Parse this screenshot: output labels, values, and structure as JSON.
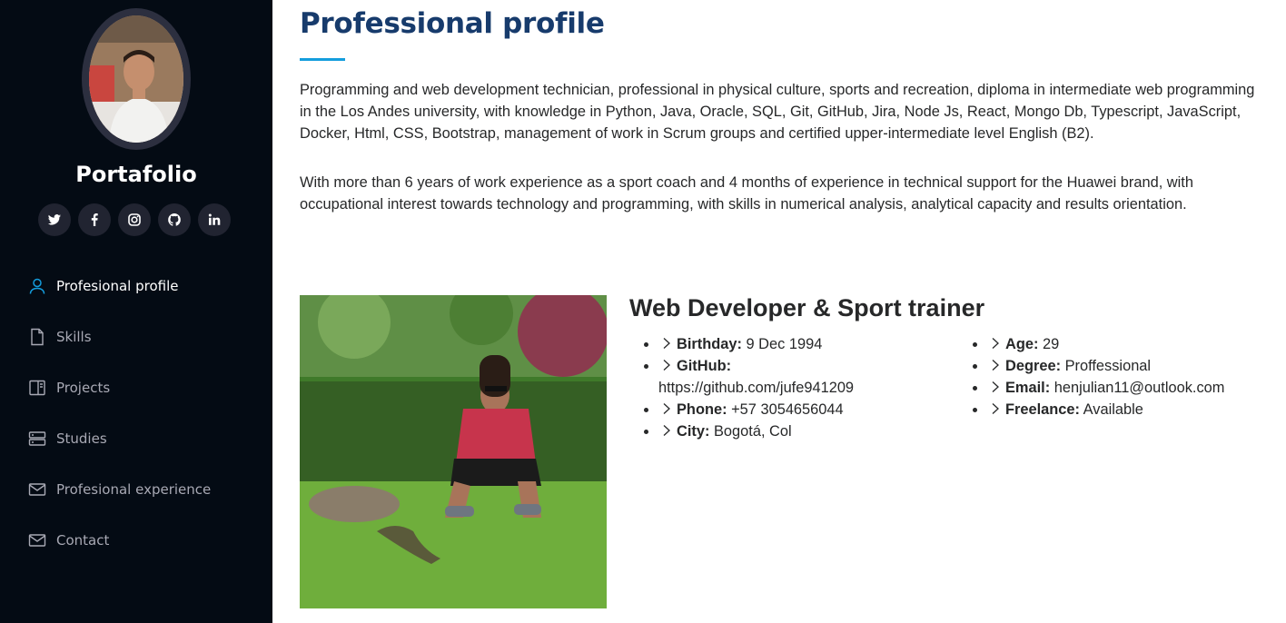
{
  "sidebar": {
    "site_title": "Portafolio",
    "social": [
      {
        "icon": "twitter-icon"
      },
      {
        "icon": "facebook-icon"
      },
      {
        "icon": "instagram-icon"
      },
      {
        "icon": "github-icon"
      },
      {
        "icon": "linkedin-icon"
      }
    ],
    "nav": [
      {
        "label": "Profesional profile",
        "icon": "person-icon",
        "active": true
      },
      {
        "label": "Skills",
        "icon": "file-icon",
        "active": false
      },
      {
        "label": "Projects",
        "icon": "layout-icon",
        "active": false
      },
      {
        "label": "Studies",
        "icon": "server-icon",
        "active": false
      },
      {
        "label": "Profesional experience",
        "icon": "envelope-icon",
        "active": false
      },
      {
        "label": "Contact",
        "icon": "envelope-icon",
        "active": false
      }
    ]
  },
  "main": {
    "section_title": "Professional profile",
    "paragraph1": "Programming and web development technician, professional in physical culture, sports and recreation, diploma in intermediate web programming in the Los Andes university, with knowledge in Python, Java, Oracle, SQL, Git, GitHub, Jira, Node Js, React, Mongo Db, Typescript, JavaScript, Docker, Html, CSS, Bootstrap, management of work in Scrum groups and certified upper-intermediate level English (B2).",
    "paragraph2": "With more than 6 years of work experience as a sport coach and 4 months of experience in technical support for the Huawei brand, with occupational interest towards technology and programming, with skills in numerical analysis, analytical capacity and results orientation.",
    "role_title": "Web Developer & Sport trainer",
    "info_left": [
      {
        "label": "Birthday:",
        "value": "9 Dec 1994"
      },
      {
        "label": "GitHub:",
        "value": "https://github.com/jufe941209"
      },
      {
        "label": "Phone:",
        "value": "+57 3054656044"
      },
      {
        "label": "City:",
        "value": "Bogotá, Col"
      }
    ],
    "info_right": [
      {
        "label": "Age:",
        "value": "29"
      },
      {
        "label": "Degree:",
        "value": "Proffessional"
      },
      {
        "label": "Email:",
        "value": "henjulian11@outlook.com"
      },
      {
        "label": "Freelance:",
        "value": "Available"
      }
    ]
  },
  "colors": {
    "sidebar_bg": "#040b14",
    "accent": "#149ddd",
    "title": "#173b6c",
    "nav_text": "#a8a9b4",
    "social_bg": "#212431"
  }
}
